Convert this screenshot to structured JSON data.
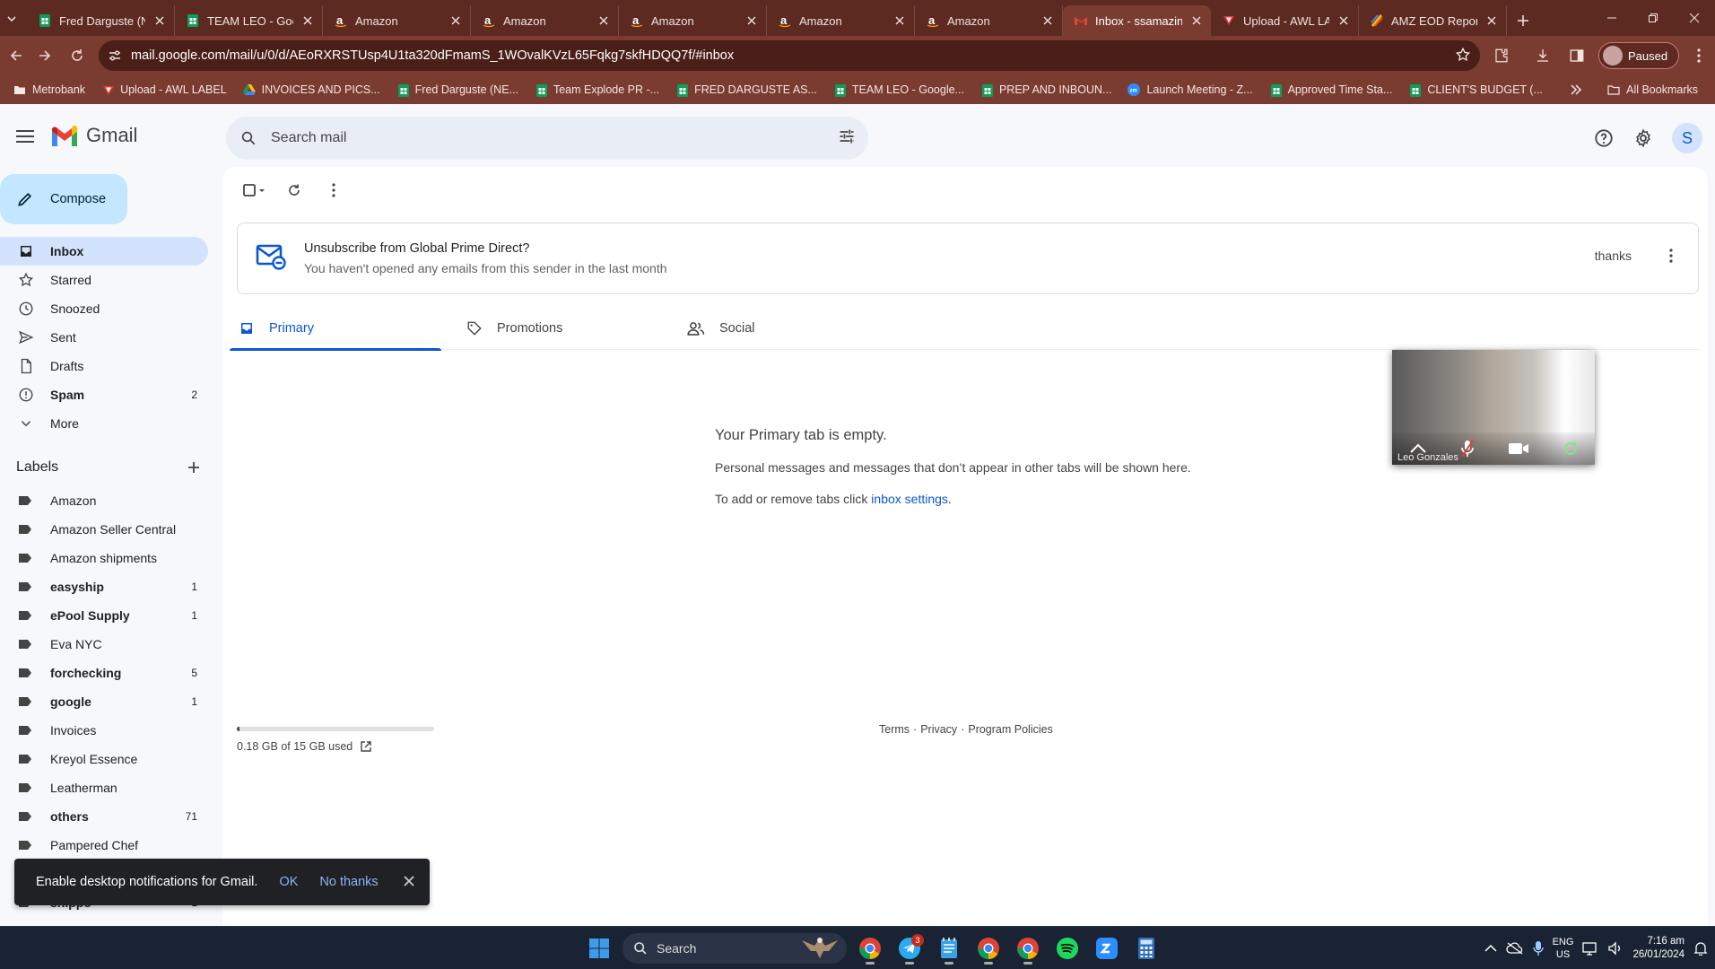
{
  "browser": {
    "tabs": [
      {
        "title": "Fred Darguste (NE",
        "favicon": "sheets-icon",
        "active": false
      },
      {
        "title": "TEAM LEO - Goog",
        "favicon": "sheets-icon",
        "active": false
      },
      {
        "title": "Amazon",
        "favicon": "amazon-icon",
        "active": false
      },
      {
        "title": "Amazon",
        "favicon": "amazon-icon",
        "active": false
      },
      {
        "title": "Amazon",
        "favicon": "amazon-icon",
        "active": false
      },
      {
        "title": "Amazon",
        "favicon": "amazon-icon",
        "active": false
      },
      {
        "title": "Amazon",
        "favicon": "amazon-icon",
        "active": false
      },
      {
        "title": "Inbox - ssamazing",
        "favicon": "gmail-icon",
        "active": true
      },
      {
        "title": "Upload - AWL LAI",
        "favicon": "awl-icon",
        "active": false
      },
      {
        "title": "AMZ EOD Report",
        "favicon": "report-icon",
        "active": false
      }
    ],
    "url": "mail.google.com/mail/u/0/d/AEoRXRSTUsp4U1ta320dFmamS_1WOvalKVzL65Fqkg7skfHDQQ7f/#inbox",
    "profile_status": "Paused",
    "bookmarks": [
      {
        "label": "Metrobank",
        "icon": "folder-icon"
      },
      {
        "label": "Upload - AWL LABEL",
        "icon": "awl-icon"
      },
      {
        "label": "INVOICES AND PICS...",
        "icon": "drive-icon"
      },
      {
        "label": "Fred Darguste (NE...",
        "icon": "sheets-icon"
      },
      {
        "label": "Team Explode PR -...",
        "icon": "sheets-icon"
      },
      {
        "label": "FRED DARGUSTE AS...",
        "icon": "sheets-icon"
      },
      {
        "label": "TEAM LEO - Google...",
        "icon": "sheets-icon"
      },
      {
        "label": "PREP AND INBOUN...",
        "icon": "sheets-icon"
      },
      {
        "label": "Launch Meeting - Z...",
        "icon": "zoom-icon"
      },
      {
        "label": "Approved Time Sta...",
        "icon": "sheets-icon"
      },
      {
        "label": "CLIENT'S BUDGET (...",
        "icon": "sheets-icon"
      }
    ],
    "all_bookmarks_label": "All Bookmarks"
  },
  "gmail": {
    "logo_text": "Gmail",
    "search_placeholder": "Search mail",
    "account_initial": "S",
    "compose_label": "Compose",
    "nav": [
      {
        "label": "Inbox",
        "icon": "inbox-icon",
        "selected": true,
        "count": ""
      },
      {
        "label": "Starred",
        "icon": "star-icon",
        "count": ""
      },
      {
        "label": "Snoozed",
        "icon": "clock-icon",
        "count": ""
      },
      {
        "label": "Sent",
        "icon": "send-icon",
        "count": ""
      },
      {
        "label": "Drafts",
        "icon": "draft-icon",
        "count": ""
      },
      {
        "label": "Spam",
        "icon": "spam-icon",
        "bold": true,
        "count": "2"
      },
      {
        "label": "More",
        "icon": "chevron-down-icon",
        "count": ""
      }
    ],
    "labels_heading": "Labels",
    "labels": [
      {
        "label": "Amazon",
        "count": "",
        "bold": false
      },
      {
        "label": "Amazon Seller Central",
        "count": "",
        "bold": false
      },
      {
        "label": "Amazon shipments",
        "count": "",
        "bold": false
      },
      {
        "label": "easyship",
        "count": "1",
        "bold": true
      },
      {
        "label": "ePool Supply",
        "count": "1",
        "bold": true
      },
      {
        "label": "Eva NYC",
        "count": "",
        "bold": false
      },
      {
        "label": "forchecking",
        "count": "5",
        "bold": true
      },
      {
        "label": "google",
        "count": "1",
        "bold": true
      },
      {
        "label": "Invoices",
        "count": "",
        "bold": false
      },
      {
        "label": "Kreyol Essence",
        "count": "",
        "bold": false
      },
      {
        "label": "Leatherman",
        "count": "",
        "bold": false
      },
      {
        "label": "others",
        "count": "71",
        "bold": true
      },
      {
        "label": "Pampered Chef",
        "count": "",
        "bold": false
      },
      {
        "label": "",
        "count": "",
        "bold": false
      },
      {
        "label": "shippo",
        "count": "1",
        "bold": true
      }
    ],
    "unsubscribe": {
      "title": "Unsubscribe from Global Prime Direct?",
      "subtitle": "You haven't opened any emails from this sender in the last month",
      "dismiss": "thanks"
    },
    "category_tabs": [
      {
        "label": "Primary",
        "icon": "inbox-icon",
        "selected": true
      },
      {
        "label": "Promotions",
        "icon": "tag-icon",
        "selected": false
      },
      {
        "label": "Social",
        "icon": "people-icon",
        "selected": false
      }
    ],
    "empty": {
      "title": "Your Primary tab is empty.",
      "subtitle": "Personal messages and messages that don’t appear in other tabs will be shown here.",
      "hint_prefix": "To add or remove tabs click ",
      "hint_link": "inbox settings",
      "hint_suffix": "."
    },
    "storage": {
      "text": "0.18 GB of 15 GB used",
      "fraction": 0.012
    },
    "footer": [
      "Terms",
      "·",
      "Privacy",
      "·",
      "Program Policies"
    ],
    "video_name": "Leo Gonzales"
  },
  "snackbar": {
    "message": "Enable desktop notifications for Gmail.",
    "ok": "OK",
    "no": "No thanks"
  },
  "taskbar": {
    "search_label": "Search",
    "apps": [
      "chrome-icon",
      "telegram-icon",
      "notepad-icon",
      "chrome-icon",
      "chrome-icon",
      "spotify-icon",
      "zoom-icon",
      "calculator-icon"
    ],
    "badges": {
      "telegram-icon": "3"
    },
    "lang_line1": "ENG",
    "lang_line2": "US",
    "time": "7:16 am",
    "date": "26/01/2024"
  },
  "colors": {
    "chrome_dark": "#5c2a21",
    "chrome": "#7a3c31",
    "gmail_blue": "#0b57d0",
    "compose": "#c2e7ff"
  }
}
